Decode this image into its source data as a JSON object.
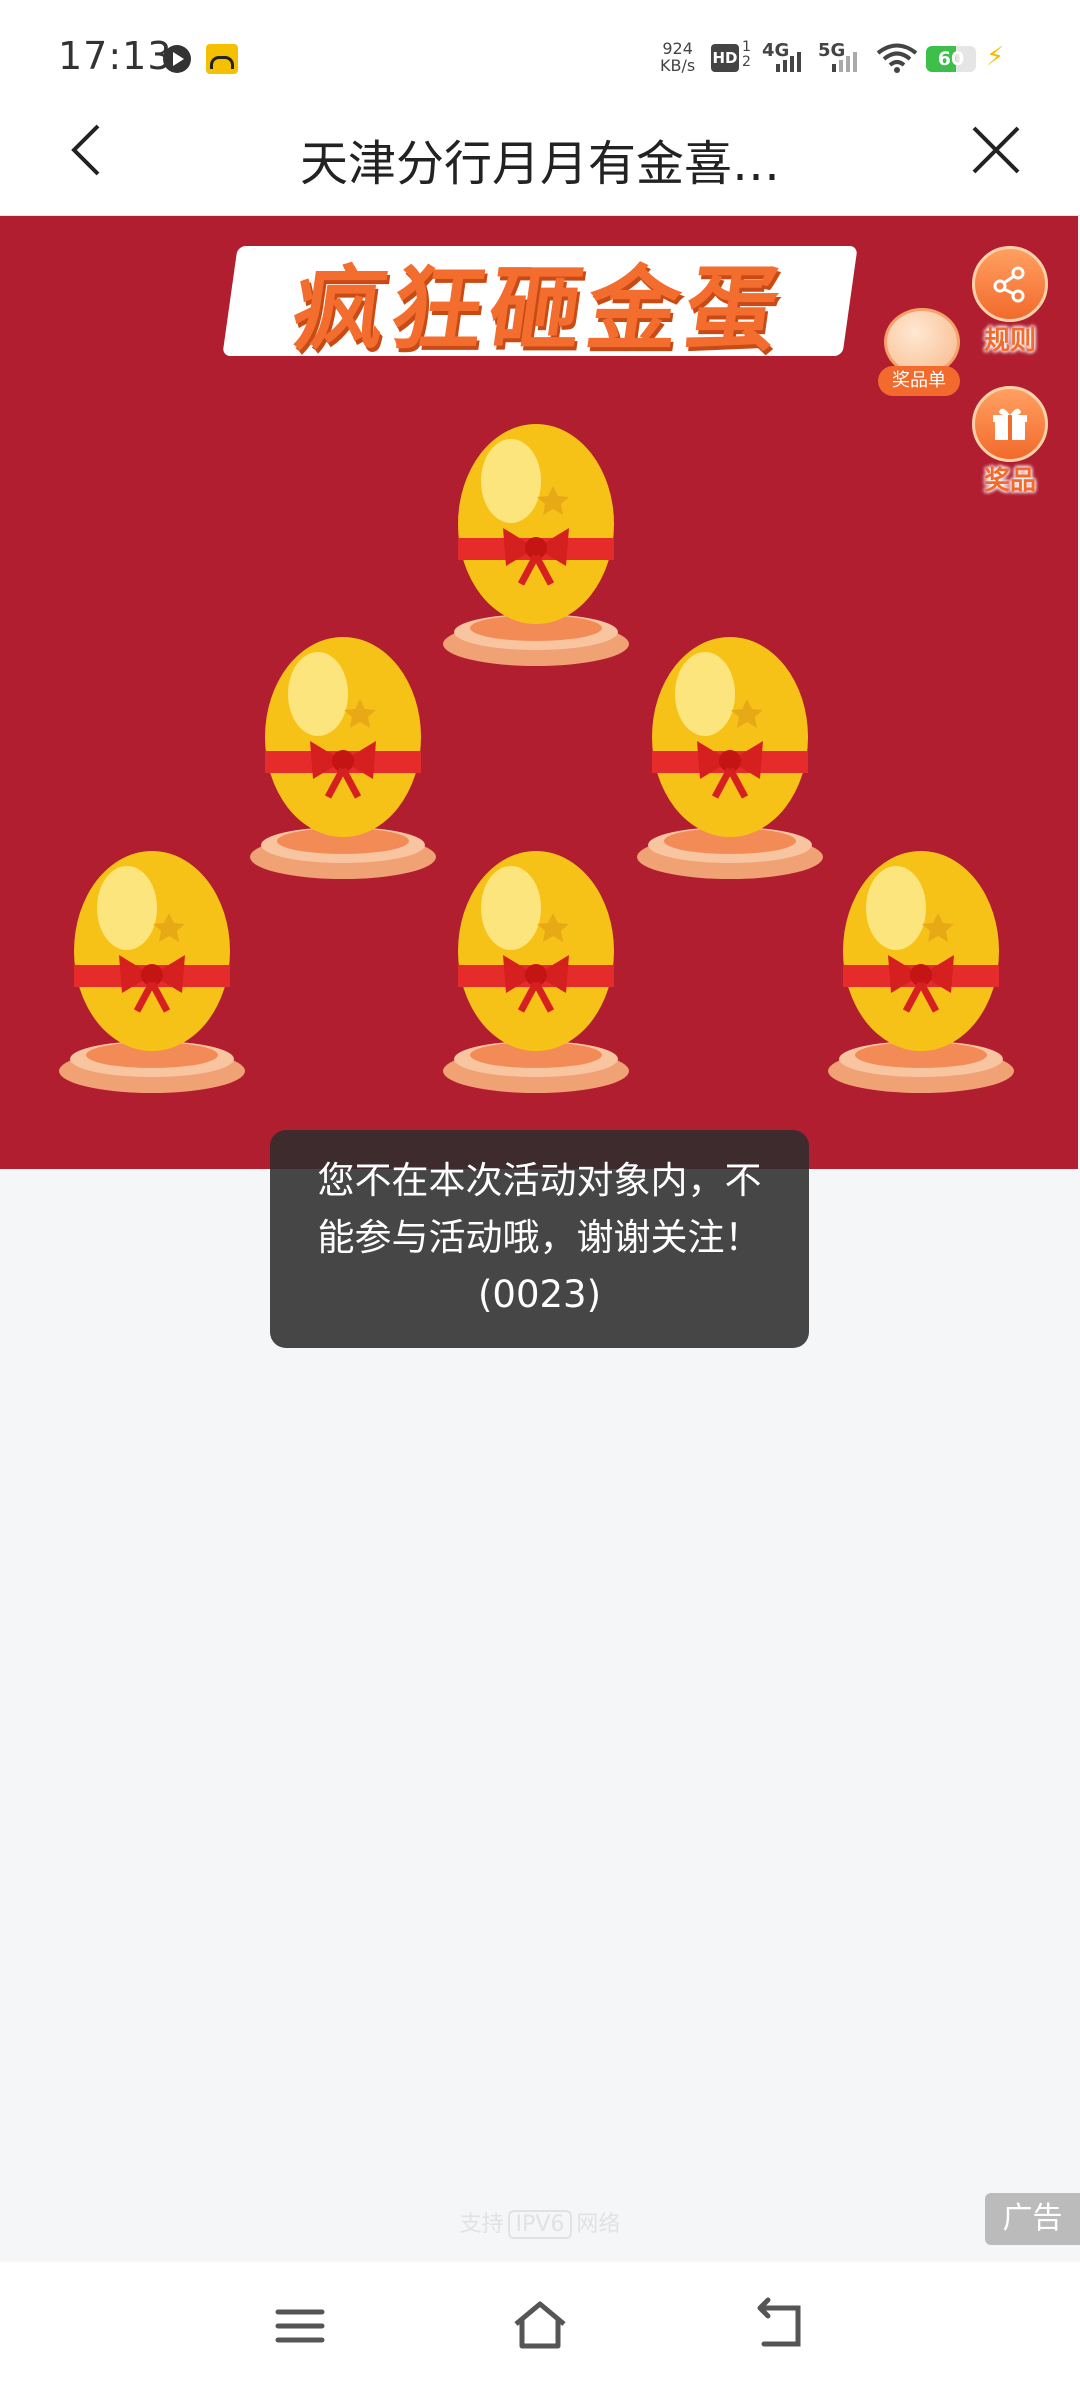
{
  "status_bar": {
    "time": "17:13",
    "net_speed_value": "924",
    "net_speed_unit": "KB/s",
    "hd_label": "HD",
    "hd_sub": "1\n2",
    "signal_1": "4G",
    "signal_2": "5G",
    "battery": "60",
    "battery_level": 0.6,
    "icons": [
      "play-icon",
      "app-icon",
      "wifi-icon",
      "battery-icon",
      "charging-icon"
    ]
  },
  "header": {
    "title": "天津分行月月有金喜…",
    "back_icon": "chevron-left-icon",
    "close_icon": "close-icon"
  },
  "game": {
    "title": "疯狂砸金蛋",
    "rules_label": "规则",
    "prizes_label": "奖品",
    "prize_list_label": "奖品单",
    "egg_count": 6,
    "colors": {
      "banner": "#b01e30",
      "accent": "#f26a2c",
      "egg": "#f7c218"
    }
  },
  "toast": {
    "message": "您不在本次活动对象内，不能参与活动哦，谢谢关注！(0023)"
  },
  "footer": {
    "ipv6_prefix": "支持",
    "ipv6_box": "IPV6",
    "ipv6_suffix": "网络",
    "ad_label": "广告"
  },
  "system_nav": {
    "icons": [
      "menu-icon",
      "home-icon",
      "back-icon"
    ]
  }
}
